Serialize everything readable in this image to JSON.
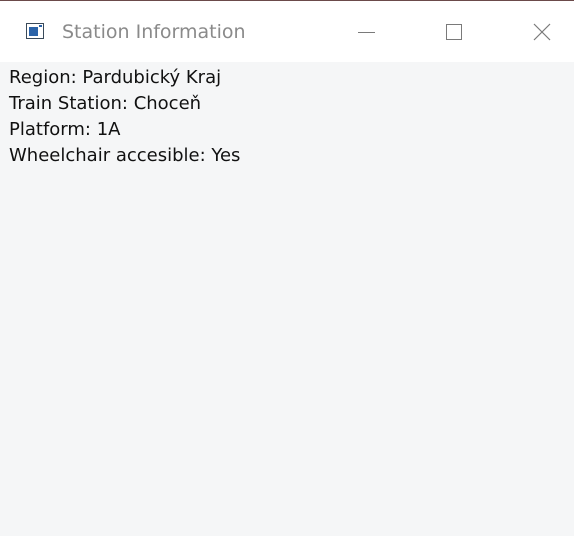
{
  "window": {
    "title": "Station Information",
    "controls": {
      "minimize": "minimize-icon",
      "maximize": "maximize-icon",
      "close": "close-icon"
    }
  },
  "info": {
    "region": "Region: Pardubický Kraj",
    "station": "Train Station: Choceň",
    "platform": "Platform: 1A",
    "wheelchair": "Wheelchair accesible: Yes"
  },
  "colors": {
    "titlebar": "#ffffff",
    "client_background": "#f5f6f7",
    "title_text": "#8a8a8a",
    "body_text": "#111111",
    "icon_accent": "#2b63a8"
  }
}
